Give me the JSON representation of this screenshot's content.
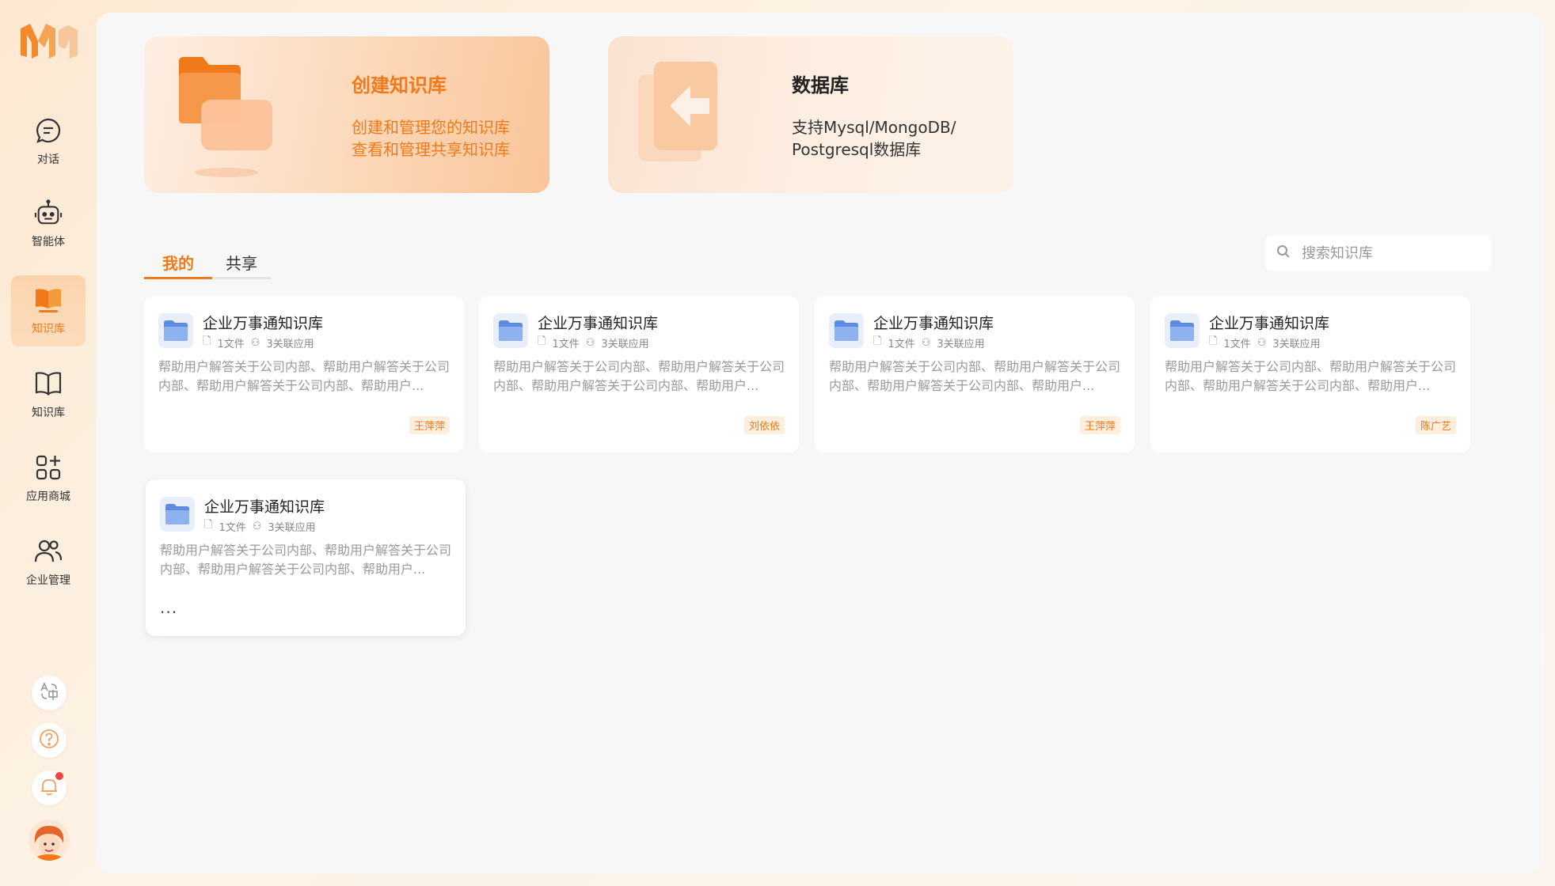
{
  "sidebar": {
    "logo": "M",
    "items": [
      {
        "label": "对话",
        "icon": "chat-icon"
      },
      {
        "label": "智能体",
        "icon": "robot-icon"
      },
      {
        "label": "知识库",
        "icon": "knowledge-book-icon",
        "active": true
      },
      {
        "label": "知识库",
        "icon": "open-book-icon"
      },
      {
        "label": "应用商城",
        "icon": "apps-icon"
      },
      {
        "label": "企业管理",
        "icon": "users-icon"
      }
    ],
    "bottom": [
      {
        "icon": "translate-icon"
      },
      {
        "icon": "help-icon"
      },
      {
        "icon": "bell-icon",
        "has_notification": true
      }
    ]
  },
  "banners": {
    "create": {
      "title": "创建知识库",
      "line1": "创建和管理您的知识库",
      "line2": "查看和管理共享知识库"
    },
    "database": {
      "title": "数据库",
      "line1": "支持Mysql/MongoDB/",
      "line2": "Postgresql数据库"
    }
  },
  "tabs": [
    {
      "label": "我的",
      "active": true
    },
    {
      "label": "共享",
      "active": false
    }
  ],
  "search": {
    "placeholder": "搜索知识库"
  },
  "cards": [
    {
      "title": "企业万事通知识库",
      "files": "1文件",
      "apps": "3关联应用",
      "desc": "帮助用户解答关于公司内部、帮助用户解答关于公司内部、帮助用户解答关于公司内部、帮助用户...",
      "owner": "王萍萍"
    },
    {
      "title": "企业万事通知识库",
      "files": "1文件",
      "apps": "3关联应用",
      "desc": "帮助用户解答关于公司内部、帮助用户解答关于公司内部、帮助用户解答关于公司内部、帮助用户...",
      "owner": "刘依依"
    },
    {
      "title": "企业万事通知识库",
      "files": "1文件",
      "apps": "3关联应用",
      "desc": "帮助用户解答关于公司内部、帮助用户解答关于公司内部、帮助用户解答关于公司内部、帮助用户...",
      "owner": "王萍萍"
    },
    {
      "title": "企业万事通知识库",
      "files": "1文件",
      "apps": "3关联应用",
      "desc": "帮助用户解答关于公司内部、帮助用户解答关于公司内部、帮助用户解答关于公司内部、帮助用户...",
      "owner": "陈广艺"
    },
    {
      "title": "企业万事通知识库",
      "files": "1文件",
      "apps": "3关联应用",
      "desc": "帮助用户解答关于公司内部、帮助用户解答关于公司内部、帮助用户解答关于公司内部、帮助用户...",
      "more": "..."
    }
  ],
  "colors": {
    "accent": "#f07a1a",
    "tag_bg": "#fdeede",
    "folder": "#7fa6e8"
  }
}
